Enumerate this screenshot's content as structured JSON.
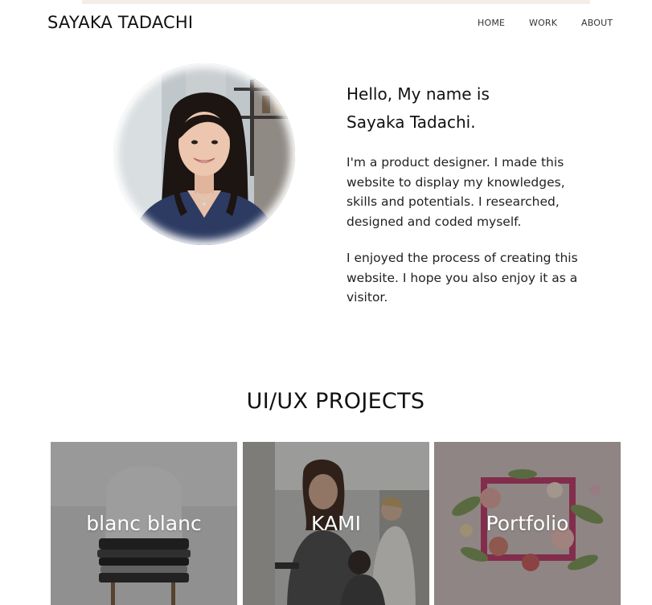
{
  "header": {
    "brand": "SAYAKA TADACHI",
    "nav": [
      "HOME",
      "WORK",
      "ABOUT"
    ]
  },
  "intro": {
    "heading_line1": "Hello, My name is",
    "heading_line2": "Sayaka Tadachi.",
    "paragraph1": "I'm a product designer. I made this website to display my knowledges, skills and potentials. I researched, designed and coded myself.",
    "paragraph2": "I enjoyed the process of creating this website. I hope you also enjoy it as a visitor."
  },
  "projects": {
    "title": "UI/UX PROJECTS",
    "items": [
      {
        "label": "blanc blanc"
      },
      {
        "label": "KAMI"
      },
      {
        "label": "Portfolio"
      }
    ]
  },
  "colors": {
    "text": "#111111",
    "card_overlay": "#1e1e1e",
    "portfolio_frame": "#c0386a"
  }
}
